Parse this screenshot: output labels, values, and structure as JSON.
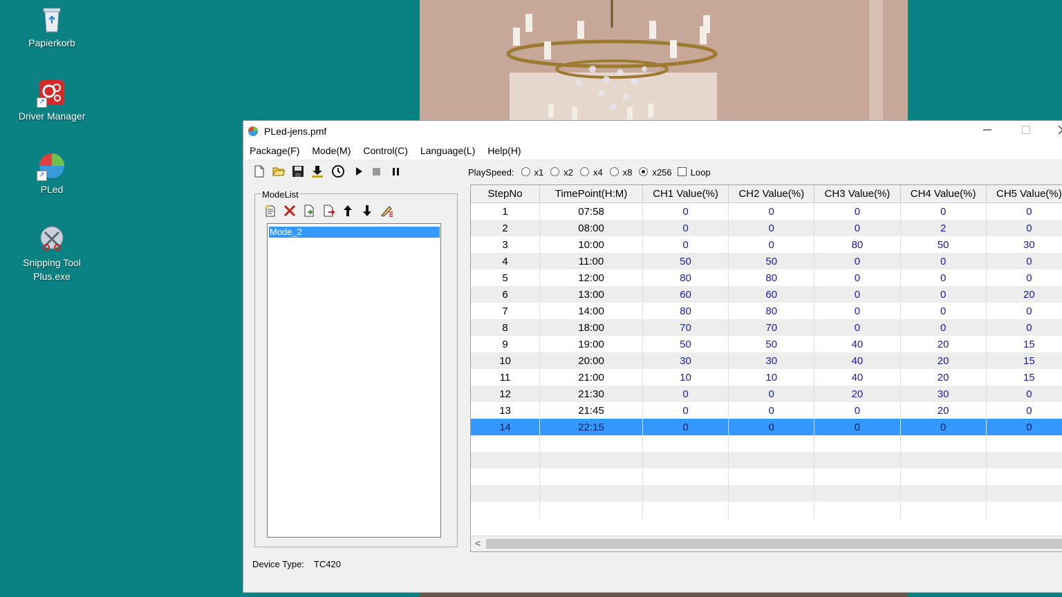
{
  "desktop": {
    "icons": [
      {
        "label": "Papierkorb",
        "icon": "recycle-bin-icon"
      },
      {
        "label": "Driver Manager",
        "icon": "driver-manager-icon"
      },
      {
        "label": "PLed",
        "icon": "pled-icon"
      },
      {
        "label": "Snipping Tool Plus.exe",
        "icon": "snipping-tool-icon"
      }
    ],
    "background_color": "#0a8284"
  },
  "window": {
    "title": "PLed-jens.pmf",
    "menu": [
      "Package(F)",
      "Mode(M)",
      "Control(C)",
      "Language(L)",
      "Help(H)"
    ],
    "toolbar_icons": [
      "new-file-icon",
      "open-folder-icon",
      "save-icon",
      "download-icon",
      "clock-icon",
      "play-icon",
      "stop-icon",
      "pause-icon"
    ],
    "playspeed": {
      "label": "PlaySpeed:",
      "options": [
        "x1",
        "x2",
        "x4",
        "x8",
        "x256"
      ],
      "selected": "x256",
      "loop_label": "Loop",
      "loop_checked": false
    },
    "modelist": {
      "label": "ModeList",
      "tool_icons": [
        "new-mode-icon",
        "delete-icon",
        "import-icon",
        "export-icon",
        "move-up-icon",
        "move-down-icon",
        "edit-icon"
      ],
      "items": [
        "Mode_2"
      ],
      "selected": "Mode_2"
    },
    "device": {
      "label": "Device Type:",
      "value": "TC420"
    },
    "grid": {
      "columns": [
        "StepNo",
        "TimePoint(H:M)",
        "CH1 Value(%)",
        "CH2 Value(%)",
        "CH3 Value(%)",
        "CH4 Value(%)",
        "CH5 Value(%)"
      ],
      "rows": [
        [
          "1",
          "07:58",
          "0",
          "0",
          "0",
          "0",
          "0"
        ],
        [
          "2",
          "08:00",
          "0",
          "0",
          "0",
          "2",
          "0"
        ],
        [
          "3",
          "10:00",
          "0",
          "0",
          "80",
          "50",
          "30"
        ],
        [
          "4",
          "11:00",
          "50",
          "50",
          "0",
          "0",
          "0"
        ],
        [
          "5",
          "12:00",
          "80",
          "80",
          "0",
          "0",
          "0"
        ],
        [
          "6",
          "13:00",
          "60",
          "60",
          "0",
          "0",
          "20"
        ],
        [
          "7",
          "14:00",
          "80",
          "80",
          "0",
          "0",
          "0"
        ],
        [
          "8",
          "18:00",
          "70",
          "70",
          "0",
          "0",
          "0"
        ],
        [
          "9",
          "19:00",
          "50",
          "50",
          "40",
          "20",
          "15"
        ],
        [
          "10",
          "20:00",
          "30",
          "30",
          "40",
          "20",
          "15"
        ],
        [
          "11",
          "21:00",
          "10",
          "10",
          "40",
          "20",
          "15"
        ],
        [
          "12",
          "21:30",
          "0",
          "0",
          "20",
          "30",
          "0"
        ],
        [
          "13",
          "21:45",
          "0",
          "0",
          "0",
          "20",
          "0"
        ],
        [
          "14",
          "22:15",
          "0",
          "0",
          "0",
          "0",
          "0"
        ]
      ],
      "selected_row": 14,
      "selection_color": "#3399ff"
    }
  }
}
